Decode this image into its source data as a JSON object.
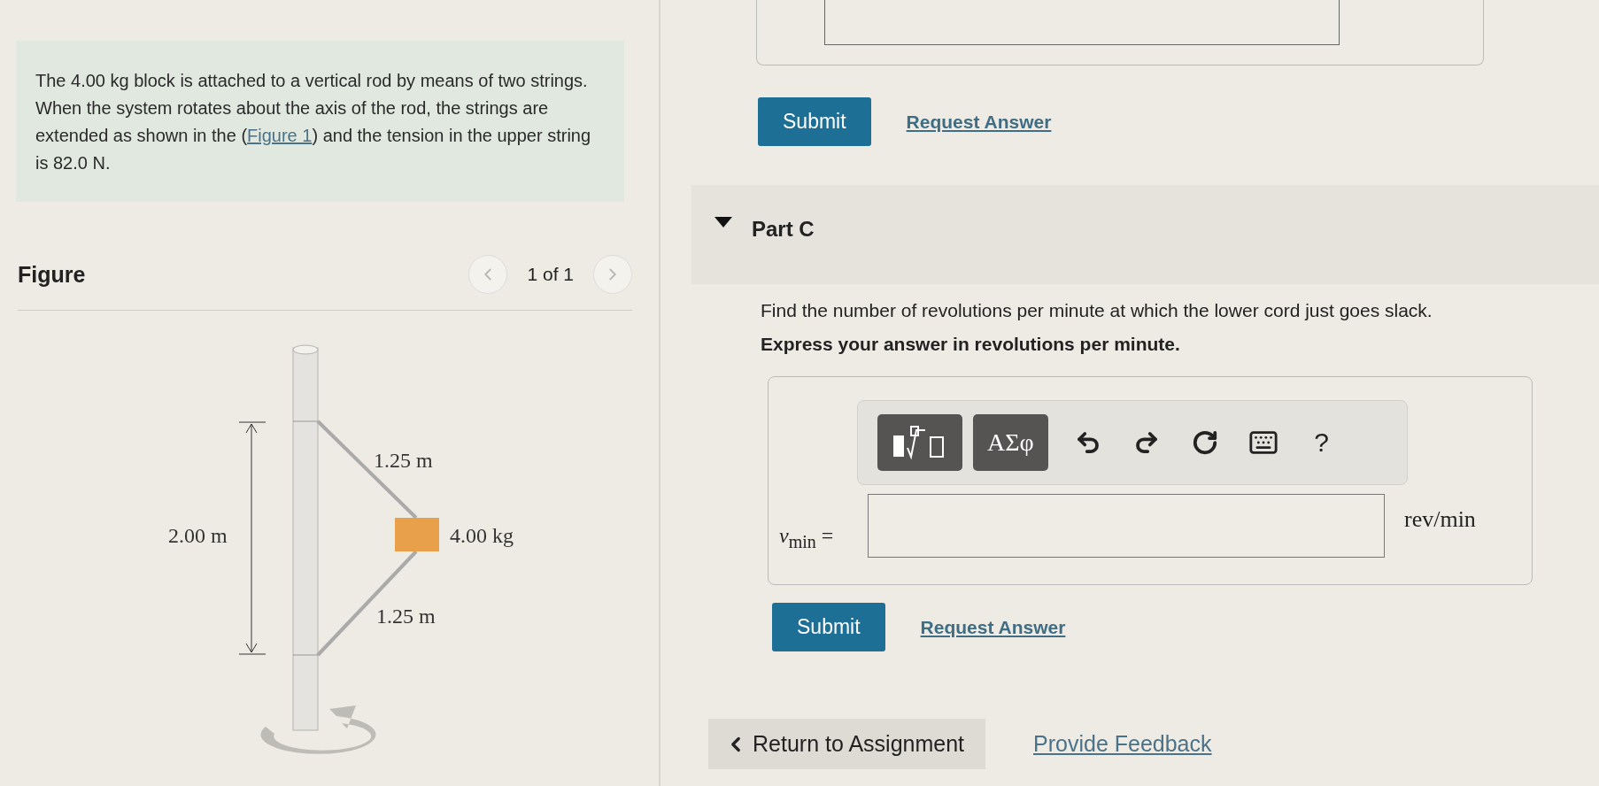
{
  "problem": {
    "before": "The 4.00 kg block is attached to a vertical rod by means of two strings. When the system rotates about the axis of the rod, the strings are extended as shown in the (",
    "link": "Figure 1",
    "after": ") and the tension in the upper string is 82.0 N."
  },
  "figure": {
    "title": "Figure",
    "pager": "1 of 1",
    "prev_disabled": true,
    "next_disabled": true,
    "labels": {
      "height": "2.00 m",
      "upper": "1.25 m",
      "mass": "4.00 kg",
      "lower": "1.25 m"
    }
  },
  "previous_part": {
    "buttons": {
      "submit": "Submit",
      "request": "Request Answer"
    }
  },
  "part": {
    "title": "Part C",
    "expanded": true,
    "question": "Find the number of revolutions per minute at which the lower cord just goes slack.",
    "instruction": "Express your answer in revolutions per minute.",
    "toolbar": [
      {
        "kind": "templates"
      },
      {
        "kind": "symbols",
        "label": "ΑΣφ"
      },
      {
        "kind": "undo"
      },
      {
        "kind": "redo"
      },
      {
        "kind": "reset"
      },
      {
        "kind": "keyboard"
      },
      {
        "kind": "help",
        "label": "?"
      }
    ],
    "variable": "*ν*$_{min}$ =",
    "unit": "rev/min",
    "buttons": {
      "submit": "Submit",
      "request": "Request Answer"
    }
  },
  "footer": {
    "return": "Return to Assignment",
    "feedback": "Provide Feedback"
  }
}
